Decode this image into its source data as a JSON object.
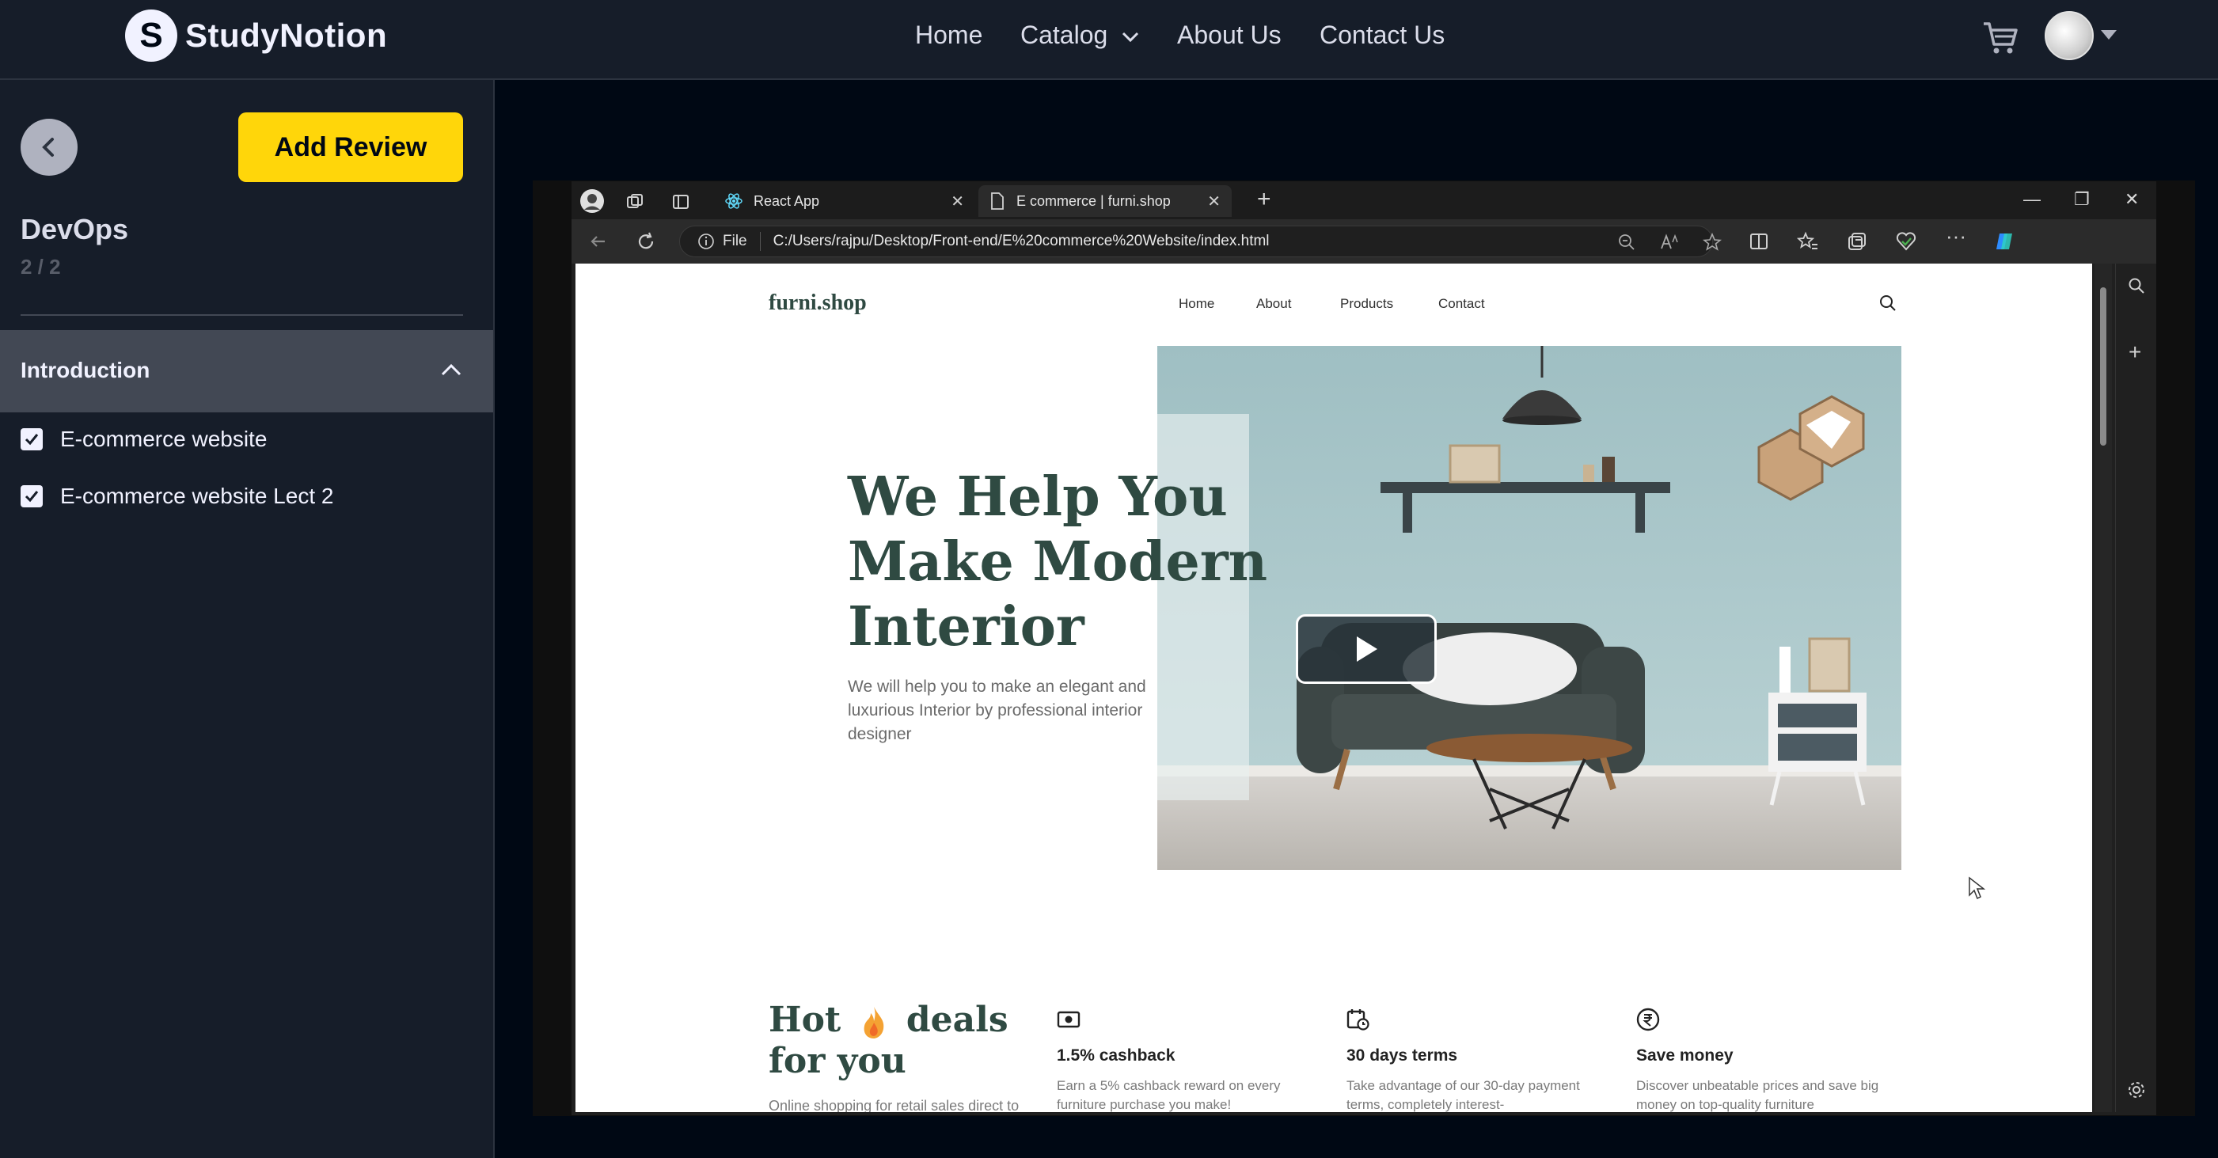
{
  "nav": {
    "logo_letter": "S",
    "logo_text": "StudyNotion",
    "links": [
      "Home",
      "Catalog",
      "About Us",
      "Contact Us"
    ]
  },
  "sidebar": {
    "add_review": "Add Review",
    "course_title": "DevOps",
    "progress": "2 / 2",
    "section": {
      "title": "Introduction",
      "lectures": [
        {
          "label": "E-commerce website",
          "checked": true
        },
        {
          "label": "E-commerce website Lect 2",
          "checked": true
        }
      ]
    }
  },
  "browser": {
    "tabs": [
      {
        "label": "React App"
      },
      {
        "label": "E commerce | furni.shop"
      }
    ],
    "address_prefix": "File",
    "address": "C:/Users/rajpu/Desktop/Front-end/E%20commerce%20Website/index.html",
    "page": {
      "logo": "furni.shop",
      "nav": [
        "Home",
        "About",
        "Products",
        "Contact"
      ],
      "hero_title": "We Help You Make Modern Interior",
      "hero_text": "We will help you to make an elegant and luxurious Interior by professional interior designer",
      "hot_title_1": "Hot",
      "hot_title_2": "deals",
      "hot_title_3": "for you",
      "hot_desc": "Online shopping for retail sales direct to",
      "features": [
        {
          "title": "1.5% cashback",
          "desc": "Earn a 5% cashback reward on every furniture purchase you make!",
          "icon": "cash-icon"
        },
        {
          "title": "30 days terms",
          "desc": "Take advantage of our 30-day payment terms, completely interest-",
          "icon": "calendar-icon"
        },
        {
          "title": "Save money",
          "desc": "Discover unbeatable prices and save big money on top-quality furniture",
          "icon": "rupee-icon"
        }
      ]
    }
  },
  "colors": {
    "accent": "#FFD60A",
    "bg": "#000814",
    "panel": "#161D29",
    "section": "#424854",
    "brand_green": "#2f4a42"
  }
}
